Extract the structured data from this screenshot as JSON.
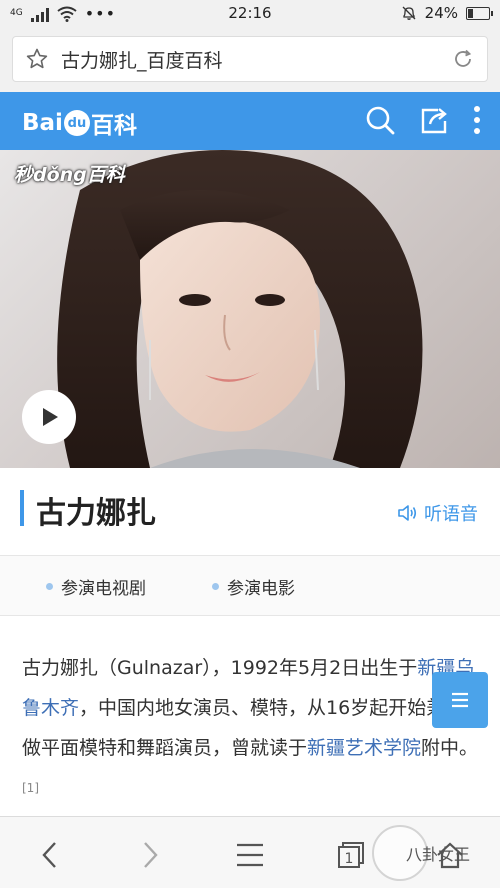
{
  "status_bar": {
    "network": "4G",
    "time": "22:16",
    "battery": "24%",
    "battery_level": 0.24
  },
  "url_bar": {
    "title": "古力娜扎_百度百科",
    "star_icon": "star-icon",
    "reload_icon": "reload-icon"
  },
  "header": {
    "logo_prefix": "Bai",
    "logo_paw": "du",
    "logo_suffix": "百科",
    "search_icon": "search-icon",
    "share_icon": "share-icon",
    "more_icon": "more-vertical-icon"
  },
  "hero": {
    "watermark": "秒dǒng百科",
    "play_icon": "play-icon"
  },
  "entry": {
    "title": "古力娜扎",
    "listen_label": "听语音"
  },
  "tags": [
    {
      "label": "参演电视剧"
    },
    {
      "label": "参演电影"
    }
  ],
  "summary": {
    "p1": "古力娜扎（Gulnazar），1992年5月2日出生于",
    "link1": "新疆乌鲁木齐",
    "p2": "，中国内地女演员、模特，从16岁起开始兼职做平面模特和舞蹈演员，曾就读于",
    "link2": "新疆艺术学院",
    "p3": "附中。",
    "ref": "[1]"
  },
  "float_button": {
    "icon": "list-icon"
  },
  "bottom_nav": {
    "tab_count": "1",
    "watermark": "八卦女王"
  },
  "colors": {
    "brand_blue": "#3e97e8",
    "link_blue": "#3e6fb6"
  }
}
